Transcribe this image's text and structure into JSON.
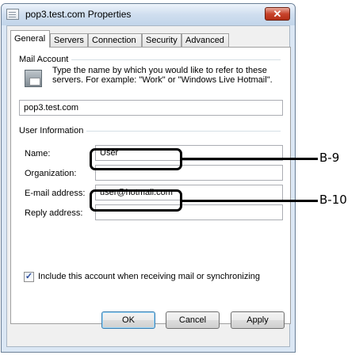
{
  "window": {
    "title": "pop3.test.com Properties",
    "close_glyph": "✕"
  },
  "tabs": [
    {
      "label": "General",
      "active": true
    },
    {
      "label": "Servers"
    },
    {
      "label": "Connection"
    },
    {
      "label": "Security"
    },
    {
      "label": "Advanced"
    }
  ],
  "mail_account": {
    "group_label": "Mail Account",
    "description": "Type the name by which you would like to refer to these servers.  For example: \"Work\" or \"Windows Live Hotmail\".",
    "account_name": "pop3.test.com"
  },
  "user_information": {
    "group_label": "User Information",
    "name_label": "Name:",
    "name_value": "User",
    "organization_label": "Organization:",
    "organization_value": "",
    "email_label": "E-mail address:",
    "email_value": "user@hotmail.com",
    "reply_label": "Reply address:",
    "reply_value": ""
  },
  "include_checkbox": {
    "label": "Include this account when receiving mail or synchronizing",
    "checked": true,
    "check_glyph": "✓"
  },
  "buttons": {
    "ok": "OK",
    "cancel": "Cancel",
    "apply": "Apply"
  },
  "callouts": {
    "name": "B-9",
    "email": "B-10"
  }
}
